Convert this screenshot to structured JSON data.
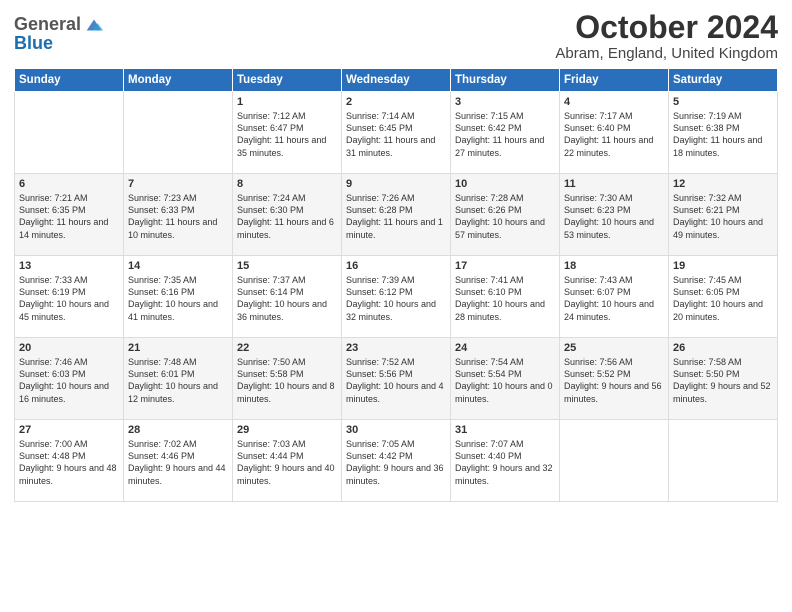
{
  "logo": {
    "general": "General",
    "blue": "Blue"
  },
  "header": {
    "month": "October 2024",
    "location": "Abram, England, United Kingdom"
  },
  "weekdays": [
    "Sunday",
    "Monday",
    "Tuesday",
    "Wednesday",
    "Thursday",
    "Friday",
    "Saturday"
  ],
  "weeks": [
    [
      {
        "day": "",
        "sunrise": "",
        "sunset": "",
        "daylight": ""
      },
      {
        "day": "",
        "sunrise": "",
        "sunset": "",
        "daylight": ""
      },
      {
        "day": "1",
        "sunrise": "Sunrise: 7:12 AM",
        "sunset": "Sunset: 6:47 PM",
        "daylight": "Daylight: 11 hours and 35 minutes."
      },
      {
        "day": "2",
        "sunrise": "Sunrise: 7:14 AM",
        "sunset": "Sunset: 6:45 PM",
        "daylight": "Daylight: 11 hours and 31 minutes."
      },
      {
        "day": "3",
        "sunrise": "Sunrise: 7:15 AM",
        "sunset": "Sunset: 6:42 PM",
        "daylight": "Daylight: 11 hours and 27 minutes."
      },
      {
        "day": "4",
        "sunrise": "Sunrise: 7:17 AM",
        "sunset": "Sunset: 6:40 PM",
        "daylight": "Daylight: 11 hours and 22 minutes."
      },
      {
        "day": "5",
        "sunrise": "Sunrise: 7:19 AM",
        "sunset": "Sunset: 6:38 PM",
        "daylight": "Daylight: 11 hours and 18 minutes."
      }
    ],
    [
      {
        "day": "6",
        "sunrise": "Sunrise: 7:21 AM",
        "sunset": "Sunset: 6:35 PM",
        "daylight": "Daylight: 11 hours and 14 minutes."
      },
      {
        "day": "7",
        "sunrise": "Sunrise: 7:23 AM",
        "sunset": "Sunset: 6:33 PM",
        "daylight": "Daylight: 11 hours and 10 minutes."
      },
      {
        "day": "8",
        "sunrise": "Sunrise: 7:24 AM",
        "sunset": "Sunset: 6:30 PM",
        "daylight": "Daylight: 11 hours and 6 minutes."
      },
      {
        "day": "9",
        "sunrise": "Sunrise: 7:26 AM",
        "sunset": "Sunset: 6:28 PM",
        "daylight": "Daylight: 11 hours and 1 minute."
      },
      {
        "day": "10",
        "sunrise": "Sunrise: 7:28 AM",
        "sunset": "Sunset: 6:26 PM",
        "daylight": "Daylight: 10 hours and 57 minutes."
      },
      {
        "day": "11",
        "sunrise": "Sunrise: 7:30 AM",
        "sunset": "Sunset: 6:23 PM",
        "daylight": "Daylight: 10 hours and 53 minutes."
      },
      {
        "day": "12",
        "sunrise": "Sunrise: 7:32 AM",
        "sunset": "Sunset: 6:21 PM",
        "daylight": "Daylight: 10 hours and 49 minutes."
      }
    ],
    [
      {
        "day": "13",
        "sunrise": "Sunrise: 7:33 AM",
        "sunset": "Sunset: 6:19 PM",
        "daylight": "Daylight: 10 hours and 45 minutes."
      },
      {
        "day": "14",
        "sunrise": "Sunrise: 7:35 AM",
        "sunset": "Sunset: 6:16 PM",
        "daylight": "Daylight: 10 hours and 41 minutes."
      },
      {
        "day": "15",
        "sunrise": "Sunrise: 7:37 AM",
        "sunset": "Sunset: 6:14 PM",
        "daylight": "Daylight: 10 hours and 36 minutes."
      },
      {
        "day": "16",
        "sunrise": "Sunrise: 7:39 AM",
        "sunset": "Sunset: 6:12 PM",
        "daylight": "Daylight: 10 hours and 32 minutes."
      },
      {
        "day": "17",
        "sunrise": "Sunrise: 7:41 AM",
        "sunset": "Sunset: 6:10 PM",
        "daylight": "Daylight: 10 hours and 28 minutes."
      },
      {
        "day": "18",
        "sunrise": "Sunrise: 7:43 AM",
        "sunset": "Sunset: 6:07 PM",
        "daylight": "Daylight: 10 hours and 24 minutes."
      },
      {
        "day": "19",
        "sunrise": "Sunrise: 7:45 AM",
        "sunset": "Sunset: 6:05 PM",
        "daylight": "Daylight: 10 hours and 20 minutes."
      }
    ],
    [
      {
        "day": "20",
        "sunrise": "Sunrise: 7:46 AM",
        "sunset": "Sunset: 6:03 PM",
        "daylight": "Daylight: 10 hours and 16 minutes."
      },
      {
        "day": "21",
        "sunrise": "Sunrise: 7:48 AM",
        "sunset": "Sunset: 6:01 PM",
        "daylight": "Daylight: 10 hours and 12 minutes."
      },
      {
        "day": "22",
        "sunrise": "Sunrise: 7:50 AM",
        "sunset": "Sunset: 5:58 PM",
        "daylight": "Daylight: 10 hours and 8 minutes."
      },
      {
        "day": "23",
        "sunrise": "Sunrise: 7:52 AM",
        "sunset": "Sunset: 5:56 PM",
        "daylight": "Daylight: 10 hours and 4 minutes."
      },
      {
        "day": "24",
        "sunrise": "Sunrise: 7:54 AM",
        "sunset": "Sunset: 5:54 PM",
        "daylight": "Daylight: 10 hours and 0 minutes."
      },
      {
        "day": "25",
        "sunrise": "Sunrise: 7:56 AM",
        "sunset": "Sunset: 5:52 PM",
        "daylight": "Daylight: 9 hours and 56 minutes."
      },
      {
        "day": "26",
        "sunrise": "Sunrise: 7:58 AM",
        "sunset": "Sunset: 5:50 PM",
        "daylight": "Daylight: 9 hours and 52 minutes."
      }
    ],
    [
      {
        "day": "27",
        "sunrise": "Sunrise: 7:00 AM",
        "sunset": "Sunset: 4:48 PM",
        "daylight": "Daylight: 9 hours and 48 minutes."
      },
      {
        "day": "28",
        "sunrise": "Sunrise: 7:02 AM",
        "sunset": "Sunset: 4:46 PM",
        "daylight": "Daylight: 9 hours and 44 minutes."
      },
      {
        "day": "29",
        "sunrise": "Sunrise: 7:03 AM",
        "sunset": "Sunset: 4:44 PM",
        "daylight": "Daylight: 9 hours and 40 minutes."
      },
      {
        "day": "30",
        "sunrise": "Sunrise: 7:05 AM",
        "sunset": "Sunset: 4:42 PM",
        "daylight": "Daylight: 9 hours and 36 minutes."
      },
      {
        "day": "31",
        "sunrise": "Sunrise: 7:07 AM",
        "sunset": "Sunset: 4:40 PM",
        "daylight": "Daylight: 9 hours and 32 minutes."
      },
      {
        "day": "",
        "sunrise": "",
        "sunset": "",
        "daylight": ""
      },
      {
        "day": "",
        "sunrise": "",
        "sunset": "",
        "daylight": ""
      }
    ]
  ]
}
